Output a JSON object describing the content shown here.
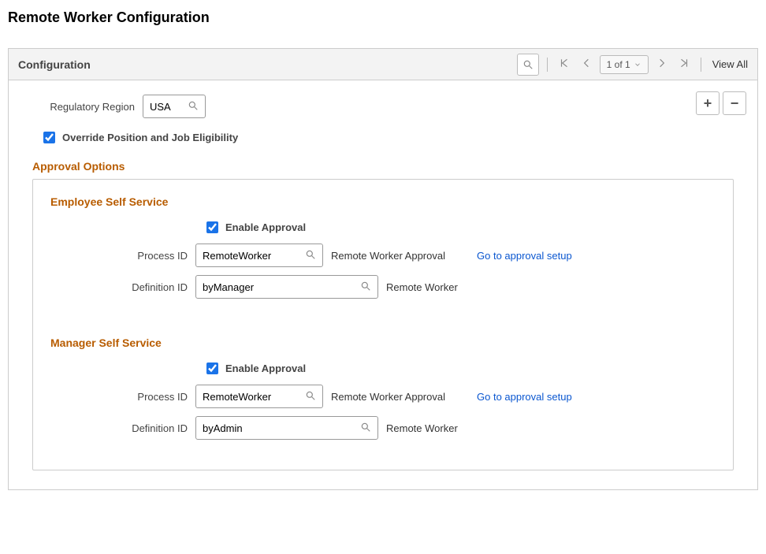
{
  "page_title": "Remote Worker Configuration",
  "panel": {
    "title": "Configuration",
    "pager": "1 of 1",
    "view_all": "View All"
  },
  "row_buttons": {
    "add": "+",
    "remove": "−"
  },
  "regulatory_region": {
    "label": "Regulatory Region",
    "value": "USA"
  },
  "override_checkbox": {
    "checked": true,
    "label": "Override Position and Job Eligibility"
  },
  "approval_section_heading": "Approval Options",
  "ess": {
    "heading": "Employee Self Service",
    "enable": {
      "checked": true,
      "label": "Enable Approval"
    },
    "process": {
      "label": "Process ID",
      "value": "RemoteWorker",
      "desc": "Remote Worker Approval"
    },
    "definition": {
      "label": "Definition ID",
      "value": "byManager",
      "desc": "Remote Worker"
    },
    "link": "Go to approval setup"
  },
  "mss": {
    "heading": "Manager Self Service",
    "enable": {
      "checked": true,
      "label": "Enable Approval"
    },
    "process": {
      "label": "Process ID",
      "value": "RemoteWorker",
      "desc": "Remote Worker Approval"
    },
    "definition": {
      "label": "Definition ID",
      "value": "byAdmin",
      "desc": "Remote Worker"
    },
    "link": "Go to approval setup"
  }
}
